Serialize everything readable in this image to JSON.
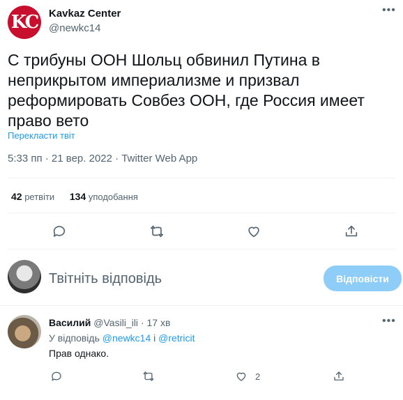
{
  "author": {
    "avatar_text": "KC",
    "name": "Kavkaz Center",
    "handle": "@newkc14"
  },
  "tweet": {
    "text": "С трибуны ООН Шольц обвинил Путина в неприкрытом империализме и призвал реформировать Совбез ООН, где Россия имеет право вето",
    "translate_label": "Перекласти твіт",
    "meta": "5:33 пп · 21 вер. 2022 · Twitter Web App"
  },
  "stats": {
    "retweets_count": "42",
    "retweets_label": "ретвіти",
    "likes_count": "134",
    "likes_label": "уподобання"
  },
  "actions": {
    "icons": [
      "reply-icon",
      "retweet-icon",
      "like-icon",
      "share-icon"
    ]
  },
  "compose": {
    "placeholder": "Твітніть відповідь",
    "button_label": "Відповісти"
  },
  "reply": {
    "name": "Василий",
    "handle": "@Vasili_ili",
    "separator": "·",
    "time": "17 хв",
    "reply_to_prefix": "У відповідь",
    "mention1": "@newkc14",
    "conjunction": "і",
    "mention2": "@retricit",
    "text": "Прав однако.",
    "like_count": "2"
  },
  "colors": {
    "accent": "#1d9bf0",
    "brand_red": "#c8102e",
    "button_disabled": "#8ecdf8",
    "secondary_text": "#536471"
  }
}
